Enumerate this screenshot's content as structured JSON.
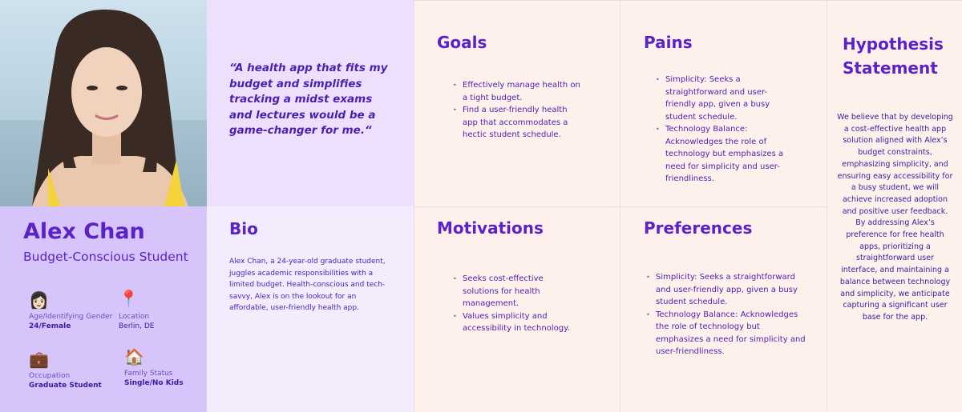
{
  "persona": {
    "name": "Alex Chan",
    "role": "Budget-Conscious Student",
    "attributes": [
      {
        "icon": "woman-icon",
        "glyph": "👩🏻",
        "label": "Age/Identifying Gender",
        "value": "24/Female"
      },
      {
        "icon": "location-pin-icon",
        "glyph": "📍",
        "label": "Location",
        "value": "Berlin, DE"
      },
      {
        "icon": "briefcase-icon",
        "glyph": "💼",
        "label": "Occupation",
        "value": "Graduate Student"
      },
      {
        "icon": "house-icon",
        "glyph": "🏠",
        "label": "Family Status",
        "value": "Single/No Kids"
      }
    ]
  },
  "quote": "“A health app that fits my budget and simplifies tracking a midst exams and lectures would be a game-changer for me.“",
  "bio": {
    "title": "Bio",
    "text": "Alex Chan, a 24-year-old graduate student, juggles academic responsibilities with a limited budget. Health-conscious and tech-savvy, Alex is on the lookout for an affordable, user-friendly health app."
  },
  "goals": {
    "title": "Goals",
    "items": [
      "Effectively manage health on a tight budget.",
      "Find a user-friendly health app that accommodates a hectic student schedule."
    ]
  },
  "pains": {
    "title": "Pains",
    "items": [
      "Simplicity: Seeks a straightforward and user-friendly app, given a busy student schedule.",
      "Technology Balance: Acknowledges the role of technology but emphasizes a need for simplicity and user-friendliness."
    ]
  },
  "motivations": {
    "title": "Motivations",
    "items": [
      "Seeks cost-effective solutions for health management.",
      "Values simplicity and accessibility in technology."
    ]
  },
  "preferences": {
    "title": "Preferences",
    "items": [
      "Simplicity: Seeks a straightforward and user-friendly app, given a busy student schedule.",
      "Technology Balance: Acknowledges the role of technology but emphasizes a need for simplicity and user-friendliness."
    ]
  },
  "hypothesis": {
    "title": "Hypothesis Statement",
    "text": "We believe that by developing a cost-effective health app solution aligned with Alex’s budget constraints, emphasizing simplicity, and ensuring easy accessibility for a busy student, we will achieve increased adoption and positive user feedback. By addressing Alex’s preference for free health apps, prioritizing a straightforward user interface, and maintaining a balance between technology and simplicity, we anticipate capturing a significant user base for the app."
  },
  "colors": {
    "accent": "#5a22c8",
    "profile_bg": "#d6c4fb",
    "quote_bg": "#eedffd",
    "card_bg": "#fef0ea"
  }
}
